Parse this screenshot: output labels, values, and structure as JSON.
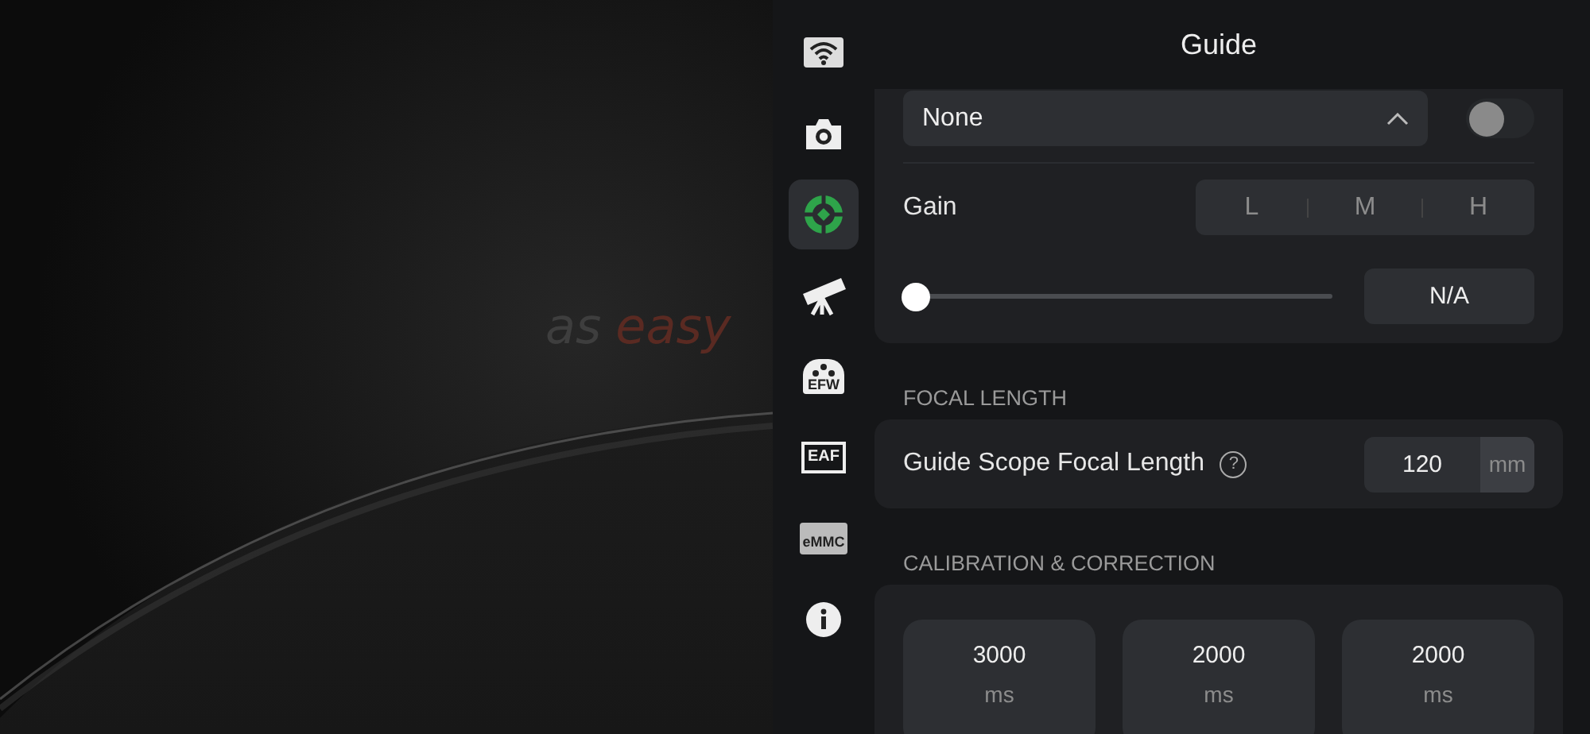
{
  "background": {
    "tagline": [
      {
        "text": "as",
        "accent": false
      },
      {
        "text": "easy",
        "accent": true
      }
    ]
  },
  "sidebar": {
    "items": [
      {
        "kind": "wifi",
        "selected": false
      },
      {
        "kind": "camera",
        "selected": false
      },
      {
        "kind": "guide",
        "selected": true
      },
      {
        "kind": "telescope",
        "selected": false
      },
      {
        "kind": "efw",
        "label": "EFW",
        "selected": false
      },
      {
        "kind": "eaf",
        "label": "EAF",
        "selected": false
      },
      {
        "kind": "emmc",
        "label": "eMMC",
        "selected": false
      },
      {
        "kind": "info",
        "selected": false
      }
    ]
  },
  "header": {
    "title": "Guide"
  },
  "guide_card": {
    "dropdown": {
      "value": "None",
      "expanded": true
    },
    "toggle": {
      "on": false
    },
    "gain": {
      "label": "Gain",
      "options": [
        {
          "label": "L",
          "selected": false
        },
        {
          "label": "M",
          "selected": false
        },
        {
          "label": "H",
          "selected": false
        }
      ]
    },
    "slider": {
      "level": 0
    },
    "slider_value": "N/A"
  },
  "focal_length": {
    "heading": "FOCAL LENGTH",
    "label": "Guide Scope Focal Length",
    "help": "?",
    "value": "120",
    "unit": "mm"
  },
  "calibration": {
    "heading": "CALIBRATION & CORRECTION",
    "tiles": [
      {
        "value": "3000",
        "unit": "ms"
      },
      {
        "value": "2000",
        "unit": "ms"
      },
      {
        "value": "2000",
        "unit": "ms"
      }
    ]
  }
}
